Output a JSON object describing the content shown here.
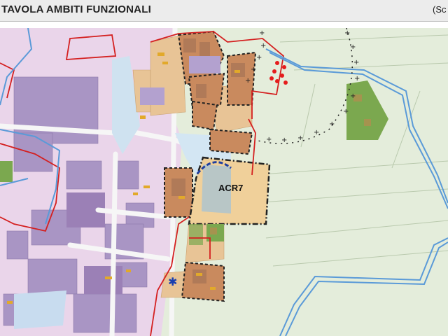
{
  "header": {
    "title": "TAVOLA AMBITI FUNZIONALI",
    "scale_note": "(Sc"
  },
  "map": {
    "zone_label": "ACR7",
    "colors": {
      "agricultural": "#e4eddb",
      "productive": "#ead5ea",
      "productive_building": "#a995c4",
      "residential": "#e8c496",
      "historic_core": "#c98a5e",
      "built_residential": "#b98d6b",
      "green_area": "#7ba84f",
      "water": "#5a9ad8",
      "water_fill": "#d3e6f3",
      "boundary_red": "#d42020",
      "boundary_black": "#222222",
      "yellow_small_buildings": "#e2a92a",
      "acr7_fill": "#f0d09a"
    },
    "icons": [
      "cross-dotted-boundary",
      "red-dot-cluster",
      "blue-star-icon"
    ]
  }
}
